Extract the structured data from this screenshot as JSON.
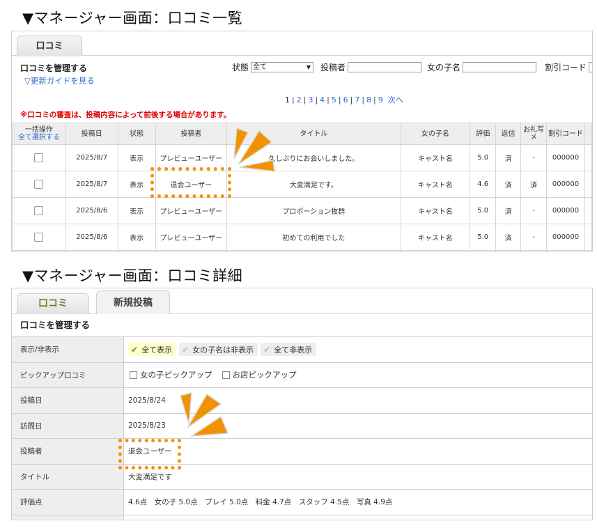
{
  "heading1": "▼マネージャー画面：口コミ一覧",
  "heading2": "▼マネージャー画面：口コミ詳細",
  "list_panel": {
    "tab_label": "口コミ",
    "title": "口コミを管理する",
    "guide_link": "▽更新ガイドを見る",
    "filter_status_label": "状態",
    "filter_status_value": "全て",
    "filter_poster_label": "投稿者",
    "filter_girl_label": "女の子名",
    "filter_discount_label": "割引コード",
    "pages": [
      "1",
      "2",
      "3",
      "4",
      "5",
      "6",
      "7",
      "8",
      "9"
    ],
    "current_page": "1",
    "next_label": "次へ",
    "notice": "※口コミの審査は、投稿内容によって前後する場合があります。",
    "columns": {
      "bulk": "一括操作",
      "select_all": "全て選択する",
      "date": "投稿日",
      "status": "状態",
      "poster": "投稿者",
      "title": "タイトル",
      "girl": "女の子名",
      "rating": "評価",
      "reply": "返信",
      "thanks": "お礼写メ",
      "code": "割引コード"
    },
    "rows": [
      {
        "date": "2025/8/7",
        "status": "表示",
        "poster": "プレビューユーザー",
        "title": "久しぶりにお会いしました。",
        "girl": "キャスト名",
        "rating": "5.0",
        "reply": "済",
        "thanks": "-",
        "code": "000000"
      },
      {
        "date": "2025/8/7",
        "status": "表示",
        "poster": "退会ユーザー",
        "title": "大変満足です。",
        "girl": "キャスト名",
        "rating": "4.6",
        "reply": "済",
        "thanks": "済",
        "code": "000000"
      },
      {
        "date": "2025/8/6",
        "status": "表示",
        "poster": "プレビューユーザー",
        "title": "プロポーション抜群",
        "girl": "キャスト名",
        "rating": "5.0",
        "reply": "済",
        "thanks": "-",
        "code": "000000"
      },
      {
        "date": "2025/8/6",
        "status": "表示",
        "poster": "プレビューユーザー",
        "title": "初めての利用でした",
        "girl": "キャスト名",
        "rating": "5.0",
        "reply": "済",
        "thanks": "-",
        "code": "000000"
      }
    ]
  },
  "detail_panel": {
    "tab_review": "口コミ",
    "tab_new": "新規投稿",
    "title": "口コミを管理する",
    "visibility_label": "表示/非表示",
    "visibility_options": [
      "全て表示",
      "女の子名は非表示",
      "全て非表示"
    ],
    "pickup_label": "ピックアップ口コミ",
    "pickup_options": [
      "女の子ピックアップ",
      "お店ピックアップ"
    ],
    "post_date_label": "投稿日",
    "post_date": "2025/8/24",
    "visit_date_label": "訪問日",
    "visit_date": "2025/8/23",
    "poster_label": "投稿者",
    "poster": "退会ユーザー",
    "title_label": "タイトル",
    "title_value": "大変満足です",
    "score_label": "評価点",
    "score_value": "4.6点　女の子 5.0点　プレイ 5.0点　料金 4.7点　スタッフ 4.5点　写真 4.9点"
  },
  "colors": {
    "highlight": "#f39200",
    "link": "#2a6bd1",
    "notice": "#e00000",
    "tab_green": "#5a8a1e"
  }
}
